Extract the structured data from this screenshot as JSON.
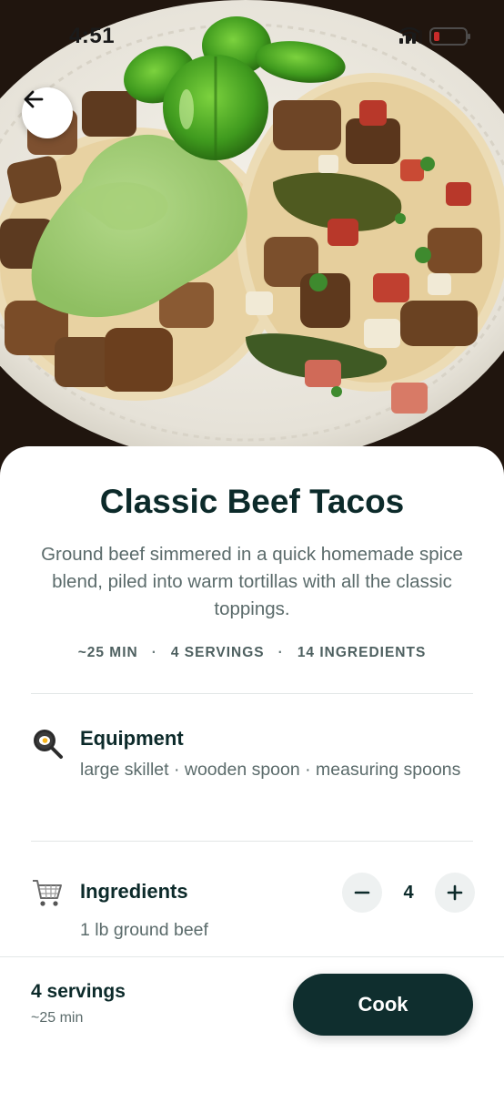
{
  "status_bar": {
    "time": "4:51",
    "battery_color": "#e53030"
  },
  "hero": {
    "icons": {
      "back": "arrow-left-icon"
    }
  },
  "recipe": {
    "title": "Classic Beef Tacos",
    "description": "Ground beef simmered in a quick homemade spice blend, piled into warm tortillas with all the classic toppings.",
    "meta": {
      "time": "~25 MIN",
      "servings": "4 SERVINGS",
      "ingredients": "14 INGREDIENTS",
      "separator": "·"
    }
  },
  "equipment": {
    "icon": "frying-pan-icon",
    "title": "Equipment",
    "items": "large skillet · wooden spoon · measuring spoons"
  },
  "ingredients": {
    "icon": "shopping-cart-icon",
    "title": "Ingredients",
    "servings_count": "4",
    "decrement_label": "−",
    "increment_label": "+",
    "items": [
      "1 lb ground beef"
    ]
  },
  "bottom_bar": {
    "servings": "4 servings",
    "time": "~25 min",
    "cook_label": "Cook"
  },
  "colors": {
    "primary_dark": "#0f2e2e",
    "text_muted": "#5b6b6b",
    "stepper_bg": "#eef1f1"
  }
}
